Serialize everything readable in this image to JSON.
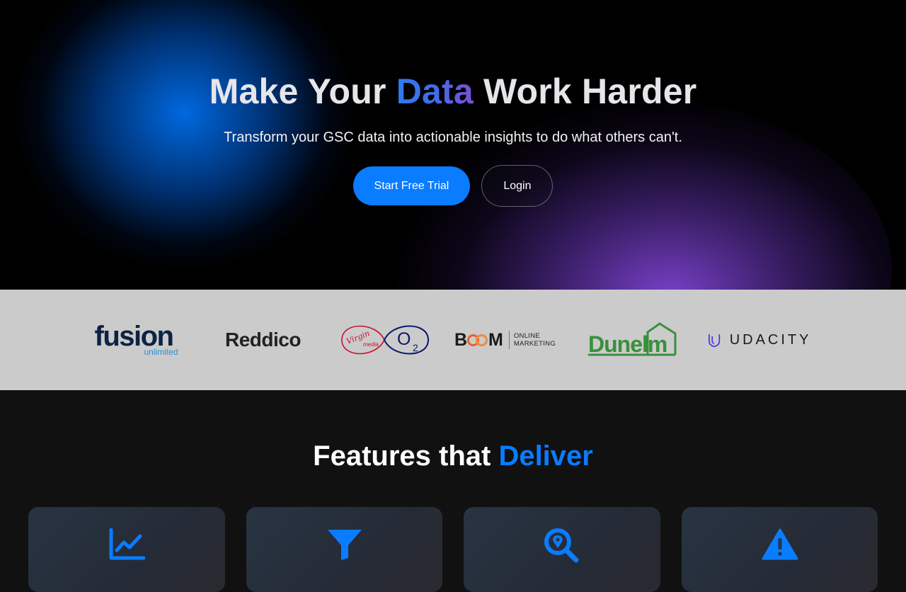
{
  "hero": {
    "title_before": "Make Your ",
    "title_accent": "Data",
    "title_after": " Work Harder",
    "subtitle": "Transform your GSC data into actionable insights to do what others can't.",
    "primary_button": "Start Free Trial",
    "secondary_button": "Login",
    "colors": {
      "primary": "#0a7cff",
      "blue_glow": "#0058d0",
      "purple_glow": "#7e44d2"
    }
  },
  "clients": {
    "logos": [
      {
        "name": "fusion",
        "sub": "unlimited",
        "icon": "fusion-logo"
      },
      {
        "name": "Reddico",
        "icon": "reddico-logo"
      },
      {
        "name": "Virgin media O2",
        "script": "Virgin",
        "script2": "media",
        "mark": "O",
        "mark_sub": "2",
        "icon": "virgin-media-o2-logo"
      },
      {
        "name": "BOOM",
        "letters": [
          "B",
          "M"
        ],
        "sub_line1": "ONLINE",
        "sub_line2": "MARKETING",
        "icon": "boom-logo"
      },
      {
        "name": "Dunelm",
        "icon": "dunelm-logo"
      },
      {
        "name": "UDACITY",
        "icon": "udacity-logo"
      }
    ]
  },
  "features": {
    "title_before": "Features that ",
    "title_accent": "Deliver",
    "cards": [
      {
        "icon": "line-chart-icon"
      },
      {
        "icon": "filter-icon"
      },
      {
        "icon": "search-location-icon"
      },
      {
        "icon": "warning-icon"
      }
    ],
    "accent_color": "#0a7cff"
  }
}
